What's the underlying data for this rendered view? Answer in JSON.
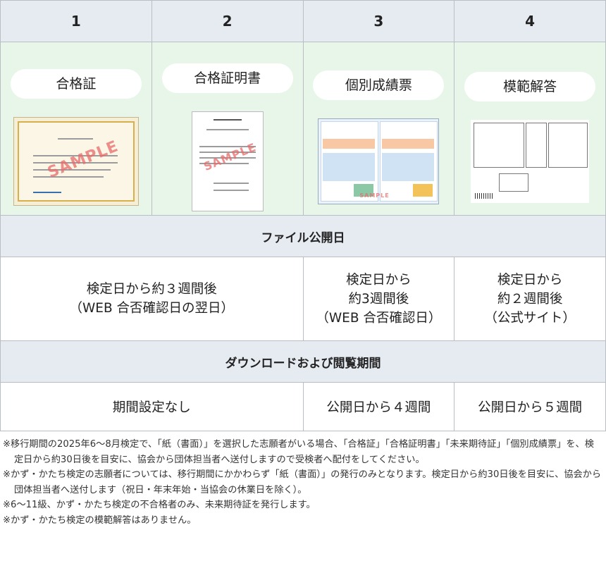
{
  "columns": [
    "1",
    "2",
    "3",
    "4"
  ],
  "documents": [
    {
      "label": "合格証",
      "thumb_text": "SAMPLE"
    },
    {
      "label": "合格証明書",
      "thumb_text": "SAMPLE"
    },
    {
      "label": "個別成績票",
      "thumb_text": "SAMPLE"
    },
    {
      "label": "模範解答"
    }
  ],
  "file_release": {
    "heading": "ファイル公開日",
    "cells": [
      {
        "lines": [
          "検定日から約３週間後",
          "（WEB 合否確認日の翌日）"
        ]
      },
      {
        "lines": [
          "検定日から",
          "約3週間後",
          "（WEB 合否確認日）"
        ]
      },
      {
        "lines": [
          "検定日から",
          "約２週間後",
          "（公式サイト）"
        ]
      }
    ]
  },
  "download_period": {
    "heading": "ダウンロードおよび閲覧期間",
    "cells": [
      "期間設定なし",
      "公開日から４週間",
      "公開日から５週間"
    ]
  },
  "notes": [
    "※移行期間の2025年6〜8月検定で、「紙（書面）」を選択した志願者がいる場合、「合格証」「合格証明書」「未来期待証」「個別成績票」を、検定日から約30日後を目安に、協会から団体担当者へ送付しますので受検者へ配付をしてください。",
    "※かず・かたち検定の志願者については、移行期間にかかわらず「紙（書面）」の発行のみとなります。検定日から約30日後を目安に、協会から団体担当者へ送付します（祝日・年末年始・当協会の休業日を除く）。",
    "※6〜11級、かず・かたち検定の不合格者のみ、未来期待証を発行します。",
    "※かず・かたち検定の模範解答はありません。"
  ]
}
